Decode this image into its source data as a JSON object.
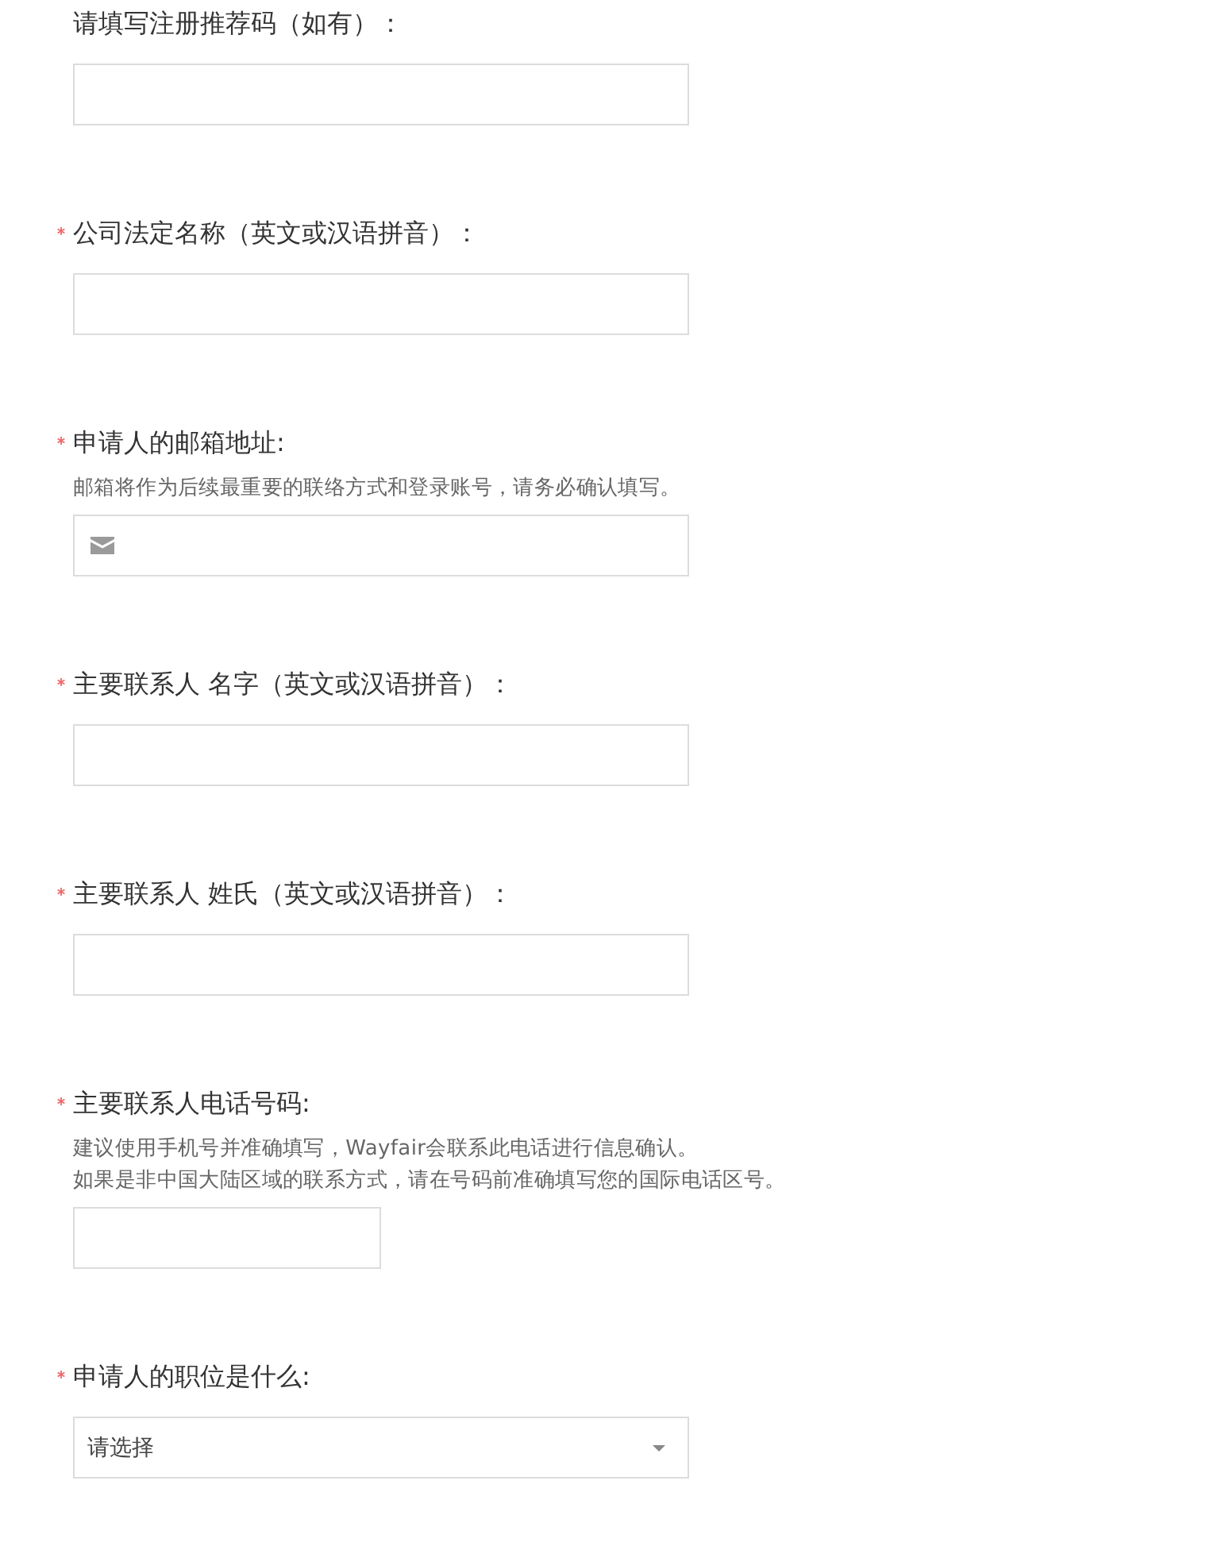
{
  "fields": [
    {
      "label": "请填写注册推荐码（如有）：",
      "required": false,
      "kind": "text"
    },
    {
      "label": "公司法定名称（英文或汉语拼音）：",
      "required": true,
      "kind": "text"
    },
    {
      "label": "申请人的邮箱地址:",
      "required": true,
      "kind": "email",
      "hints": [
        "邮箱将作为后续最重要的联络方式和登录账号，请务必确认填写。"
      ]
    },
    {
      "label": "主要联系人 名字（英文或汉语拼音）：",
      "required": true,
      "kind": "text"
    },
    {
      "label": "主要联系人 姓氏（英文或汉语拼音）：",
      "required": true,
      "kind": "text"
    },
    {
      "label": "主要联系人电话号码:",
      "required": true,
      "kind": "phone",
      "hints": [
        "建议使用手机号并准确填写，Wayfair会联系此电话进行信息确认。",
        "如果是非中国大陆区域的联系方式，请在号码前准确填写您的国际电话区号。"
      ]
    },
    {
      "label": "申请人的职位是什么:",
      "required": true,
      "kind": "select",
      "placeholder": "请选择"
    }
  ]
}
